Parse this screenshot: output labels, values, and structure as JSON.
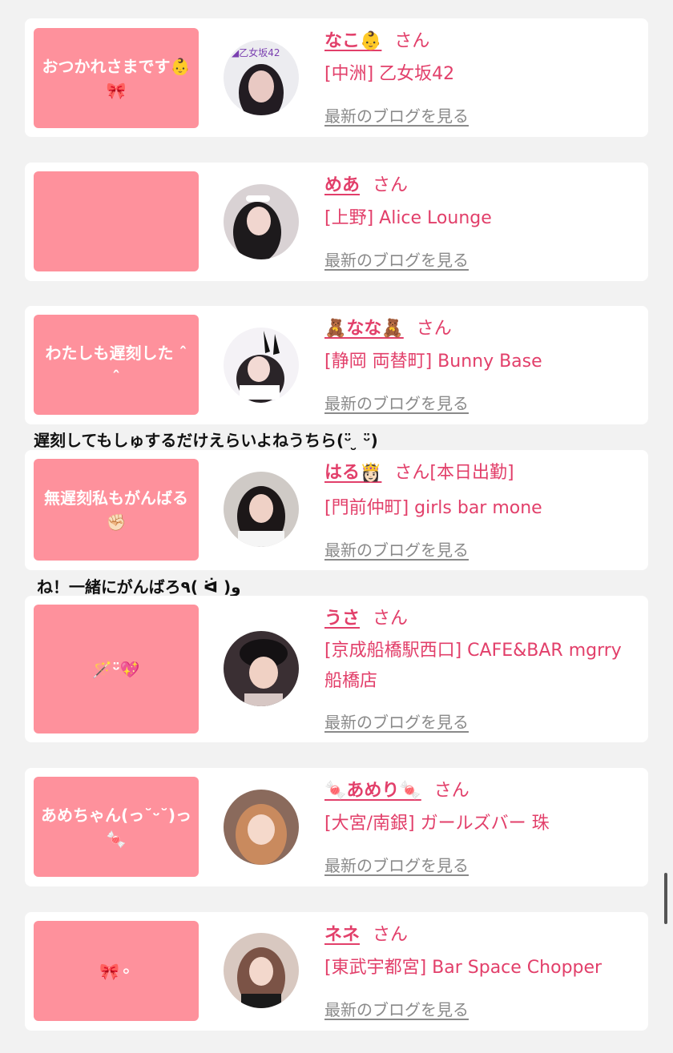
{
  "colors": {
    "accent": "#e23f6a",
    "bubble": "#fe919c",
    "link_gray": "#8a8a8a"
  },
  "cards": [
    {
      "message": "おつかれさまです👶🎀",
      "name": "なこ👶",
      "suffix": "さん",
      "status": "",
      "store": "[中洲] 乙女坂42",
      "blog_link": "最新のブログを見る",
      "avatar": "avatar-photo"
    },
    {
      "message": "",
      "name": "めあ",
      "suffix": "さん",
      "status": "",
      "store": "[上野] Alice Lounge",
      "blog_link": "最新のブログを見る",
      "avatar": "avatar-photo"
    },
    {
      "message": "わたしも遅刻した ˆ ˆ",
      "name": "🧸なな🧸",
      "suffix": "さん",
      "status": "",
      "store": "[静岡 両替町] Bunny Base",
      "blog_link": "最新のブログを見る",
      "avatar": "avatar-photo"
    },
    {
      "message": "無遅刻私もがんばる✊🏻",
      "name": "はる👸🏻",
      "suffix": "さん",
      "status": "[本日出勤]",
      "store": "[門前仲町] girls bar mone",
      "blog_link": "最新のブログを見る",
      "avatar": "avatar-photo"
    },
    {
      "message": "🪄ᵕ̈💖",
      "name": "うさ",
      "suffix": "さん",
      "status": "",
      "store": "[京成船橋駅西口] CAFE&BAR mgrry 船橋店",
      "blog_link": "最新のブログを見る",
      "avatar": "avatar-photo"
    },
    {
      "message": "あめちゃん(っ˘ᵕ˘)っ🍬",
      "name": "🍬あめり🍬",
      "suffix": "さん",
      "status": "",
      "store": "[大宮/南銀] ガールズバー 珠",
      "blog_link": "最新のブログを見る",
      "avatar": "avatar-photo"
    },
    {
      "message": "🎀⚬",
      "name": "ネネ",
      "suffix": "さん",
      "status": "",
      "store": "[東武宇都宮] Bar Space Chopper",
      "blog_link": "最新のブログを見る",
      "avatar": "avatar-photo"
    }
  ],
  "overflow_texts": [
    "遅刻してもしゅするだけえらいよねうちら(ᵕ̈ ̮ ᵕ̈)",
    "ね！一緒にがんばろ٩( ᐛ )و"
  ]
}
